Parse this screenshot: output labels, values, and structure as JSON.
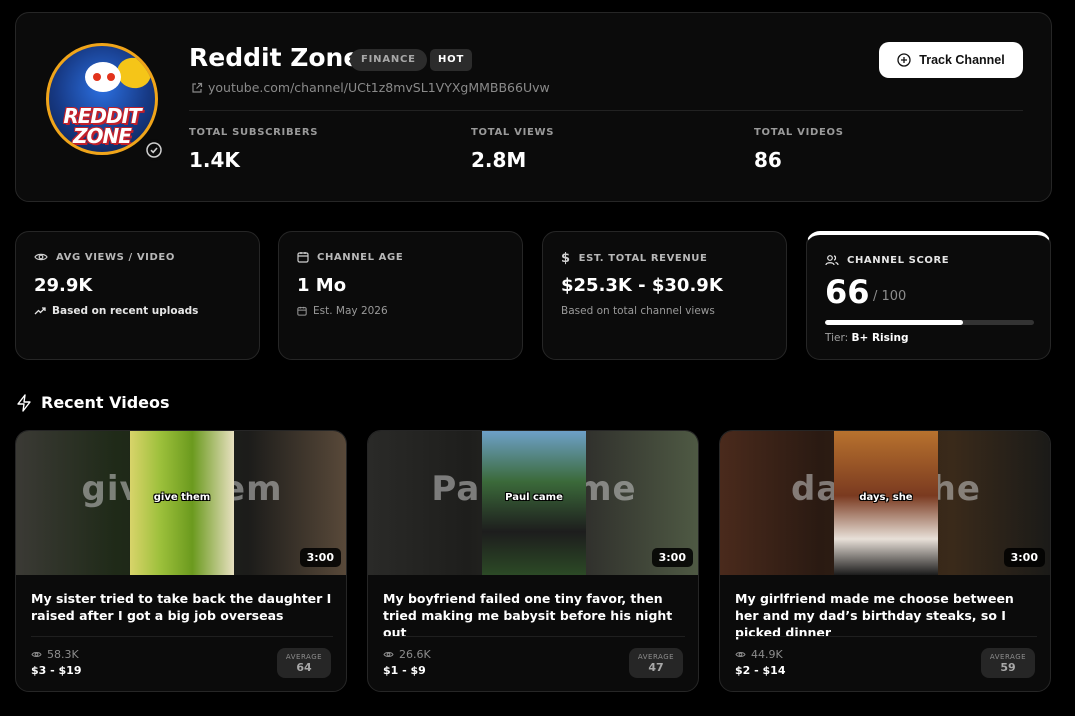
{
  "channel": {
    "name": "Reddit Zone",
    "tags": {
      "category": "FINANCE",
      "hot": "HOT"
    },
    "url": "youtube.com/channel/UCt1z8mvSL1VYXgMMBB66Uvw",
    "avatar_text": {
      "line1": "REDDIT",
      "line2": "ZONE"
    },
    "track_label": "Track Channel",
    "stats": {
      "subscribers_label": "TOTAL SUBSCRIBERS",
      "subscribers": "1.4K",
      "views_label": "TOTAL VIEWS",
      "views": "2.8M",
      "videos_label": "TOTAL VIDEOS",
      "videos": "86"
    }
  },
  "metrics": {
    "avg_views": {
      "label": "AVG VIEWS / VIDEO",
      "value": "29.9K",
      "sub": "Based on recent uploads"
    },
    "age": {
      "label": "CHANNEL AGE",
      "value": "1 Mo",
      "sub": "Est. May 2026"
    },
    "revenue": {
      "label": "EST. TOTAL REVENUE",
      "value": "$25.3K - $30.9K",
      "sub": "Based on total channel views"
    },
    "score": {
      "label": "CHANNEL SCORE",
      "value": "66",
      "max": "/ 100",
      "fraction": 0.66,
      "tier_label": "Tier:",
      "tier": "B+ Rising"
    }
  },
  "recent": {
    "title": "Recent Videos",
    "videos": [
      {
        "title": "My sister tried to take back the daughter I raised after I got a big job overseas",
        "bg_text": "give them",
        "caption": "give them",
        "duration": "3:00",
        "views": "58.3K",
        "revenue": "$3 - $19",
        "badge_label": "AVERAGE",
        "badge_value": "64"
      },
      {
        "title": "My boyfriend failed one tiny favor, then tried making me babysit before his night out",
        "bg_text": "Paul came",
        "caption": "Paul came",
        "duration": "3:00",
        "views": "26.6K",
        "revenue": "$1 - $9",
        "badge_label": "AVERAGE",
        "badge_value": "47"
      },
      {
        "title": "My girlfriend made me choose between her and my dad’s birthday steaks, so I picked dinner",
        "bg_text": "days, she",
        "caption": "days, she",
        "duration": "3:00",
        "views": "44.9K",
        "revenue": "$2 - $14",
        "badge_label": "AVERAGE",
        "badge_value": "59"
      }
    ]
  },
  "colors": {
    "background": "#000000",
    "card": "#0b0b0b",
    "border": "#262626",
    "accent": "#ffffff"
  }
}
